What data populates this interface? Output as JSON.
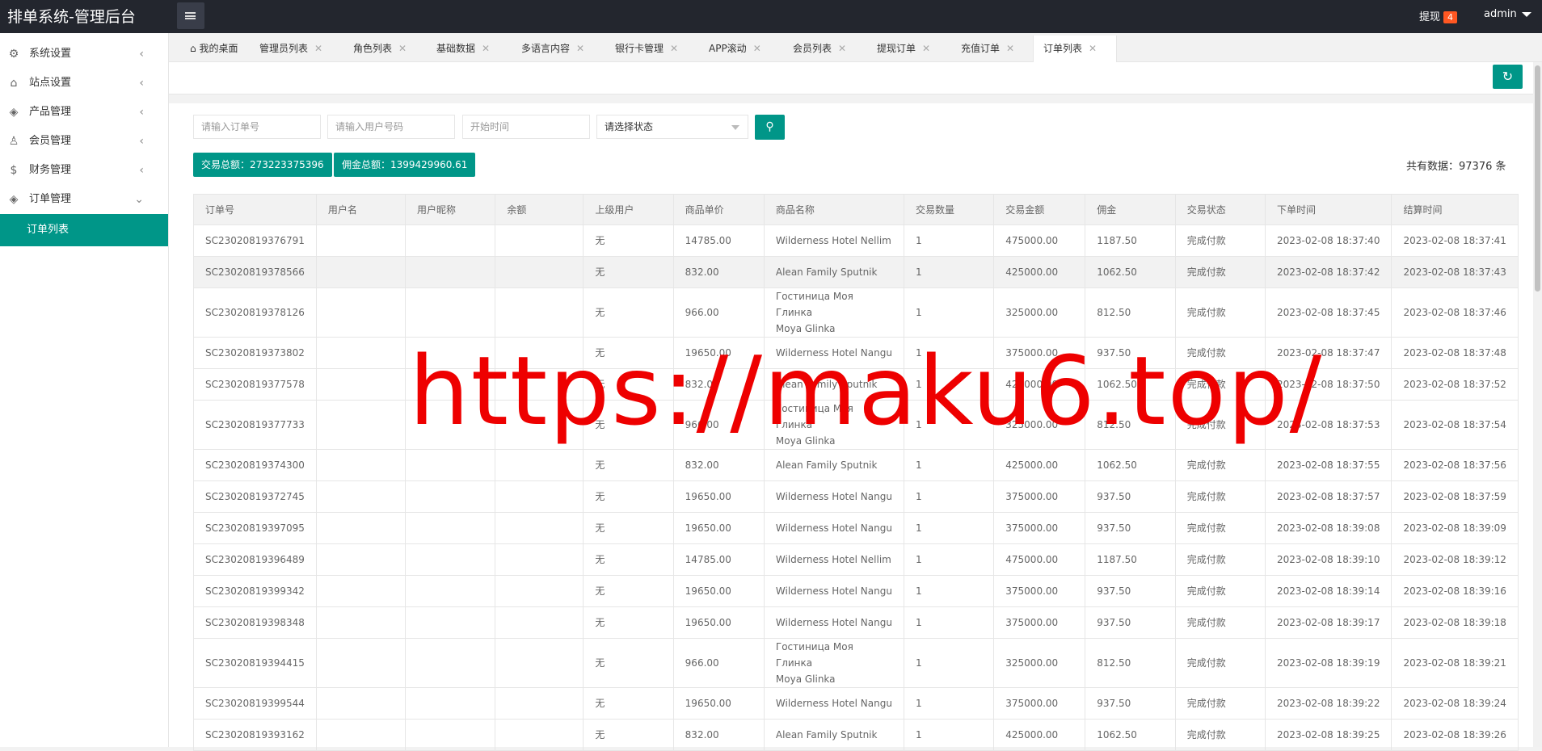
{
  "header": {
    "brand": "排单系统-管理后台",
    "withdraw_label": "提现",
    "withdraw_badge": "4",
    "user": "admin"
  },
  "sidebar": {
    "items": [
      {
        "label": "系统设置",
        "icon": "gear-icon"
      },
      {
        "label": "站点设置",
        "icon": "home-icon"
      },
      {
        "label": "产品管理",
        "icon": "cube-icon"
      },
      {
        "label": "会员管理",
        "icon": "user-icon"
      },
      {
        "label": "财务管理",
        "icon": "dollar-icon"
      },
      {
        "label": "订单管理",
        "icon": "cube-icon"
      }
    ],
    "active_sub": "订单列表"
  },
  "tabs": [
    "我的桌面",
    "管理员列表",
    "角色列表",
    "基础数据",
    "多语言内容",
    "银行卡管理",
    "APP滚动",
    "会员列表",
    "提现订单",
    "充值订单",
    "订单列表"
  ],
  "filters": {
    "order_no": "请输入订单号",
    "user_no": "请输入用户号码",
    "start_time": "开始时间",
    "status": "请选择状态"
  },
  "summary": {
    "trade_total": "交易总额：273223375396",
    "commission_total": "佣金总额：1399429960.61",
    "count": "共有数据：97376 条"
  },
  "table": {
    "headers": [
      "订单号",
      "用户名",
      "用户昵称",
      "余额",
      "上级用户",
      "商品单价",
      "商品名称",
      "交易数量",
      "交易金额",
      "佣金",
      "交易状态",
      "下单时间",
      "结算时间"
    ],
    "rows": [
      [
        "SC23020819376791",
        "",
        "",
        "",
        "无",
        "14785.00",
        "Wilderness Hotel Nellim",
        "1",
        "475000.00",
        "1187.50",
        "完成付款",
        "2023-02-08 18:37:40",
        "2023-02-08 18:37:41"
      ],
      [
        "SC23020819378566",
        "",
        "",
        "",
        "无",
        "832.00",
        "Alean Family Sputnik",
        "1",
        "425000.00",
        "1062.50",
        "完成付款",
        "2023-02-08 18:37:42",
        "2023-02-08 18:37:43"
      ],
      [
        "SC23020819378126",
        "",
        "",
        "",
        "无",
        "966.00",
        "Гостиница Моя Глинка\nMoya Glinka",
        "1",
        "325000.00",
        "812.50",
        "完成付款",
        "2023-02-08 18:37:45",
        "2023-02-08 18:37:46"
      ],
      [
        "SC23020819373802",
        "",
        "",
        "",
        "无",
        "19650.00",
        "Wilderness Hotel Nangu",
        "1",
        "375000.00",
        "937.50",
        "完成付款",
        "2023-02-08 18:37:47",
        "2023-02-08 18:37:48"
      ],
      [
        "SC23020819377578",
        "",
        "",
        "",
        "无",
        "832.00",
        "Alean Family Sputnik",
        "1",
        "425000.00",
        "1062.50",
        "完成付款",
        "2023-02-08 18:37:50",
        "2023-02-08 18:37:52"
      ],
      [
        "SC23020819377733",
        "",
        "",
        "",
        "无",
        "966.00",
        "Гостиница Моя Глинка\nMoya Glinka",
        "1",
        "325000.00",
        "812.50",
        "完成付款",
        "2023-02-08 18:37:53",
        "2023-02-08 18:37:54"
      ],
      [
        "SC23020819374300",
        "",
        "",
        "",
        "无",
        "832.00",
        "Alean Family Sputnik",
        "1",
        "425000.00",
        "1062.50",
        "完成付款",
        "2023-02-08 18:37:55",
        "2023-02-08 18:37:56"
      ],
      [
        "SC23020819372745",
        "",
        "",
        "",
        "无",
        "19650.00",
        "Wilderness Hotel Nangu",
        "1",
        "375000.00",
        "937.50",
        "完成付款",
        "2023-02-08 18:37:57",
        "2023-02-08 18:37:59"
      ],
      [
        "SC23020819397095",
        "",
        "",
        "",
        "无",
        "19650.00",
        "Wilderness Hotel Nangu",
        "1",
        "375000.00",
        "937.50",
        "完成付款",
        "2023-02-08 18:39:08",
        "2023-02-08 18:39:09"
      ],
      [
        "SC23020819396489",
        "",
        "",
        "",
        "无",
        "14785.00",
        "Wilderness Hotel Nellim",
        "1",
        "475000.00",
        "1187.50",
        "完成付款",
        "2023-02-08 18:39:10",
        "2023-02-08 18:39:12"
      ],
      [
        "SC23020819399342",
        "",
        "",
        "",
        "无",
        "19650.00",
        "Wilderness Hotel Nangu",
        "1",
        "375000.00",
        "937.50",
        "完成付款",
        "2023-02-08 18:39:14",
        "2023-02-08 18:39:16"
      ],
      [
        "SC23020819398348",
        "",
        "",
        "",
        "无",
        "19650.00",
        "Wilderness Hotel Nangu",
        "1",
        "375000.00",
        "937.50",
        "完成付款",
        "2023-02-08 18:39:17",
        "2023-02-08 18:39:18"
      ],
      [
        "SC23020819394415",
        "",
        "",
        "",
        "无",
        "966.00",
        "Гостиница Моя Глинка\nMoya Glinka",
        "1",
        "325000.00",
        "812.50",
        "完成付款",
        "2023-02-08 18:39:19",
        "2023-02-08 18:39:21"
      ],
      [
        "SC23020819399544",
        "",
        "",
        "",
        "无",
        "19650.00",
        "Wilderness Hotel Nangu",
        "1",
        "375000.00",
        "937.50",
        "完成付款",
        "2023-02-08 18:39:22",
        "2023-02-08 18:39:24"
      ],
      [
        "SC23020819393162",
        "",
        "",
        "",
        "无",
        "832.00",
        "Alean Family Sputnik",
        "1",
        "425000.00",
        "1062.50",
        "完成付款",
        "2023-02-08 18:39:25",
        "2023-02-08 18:39:26"
      ]
    ]
  },
  "watermark": "https://maku6.top/",
  "colors": {
    "accent": "#009688",
    "topbar": "#23262e",
    "badge": "#ff5722",
    "watermark": "#ee0000"
  }
}
